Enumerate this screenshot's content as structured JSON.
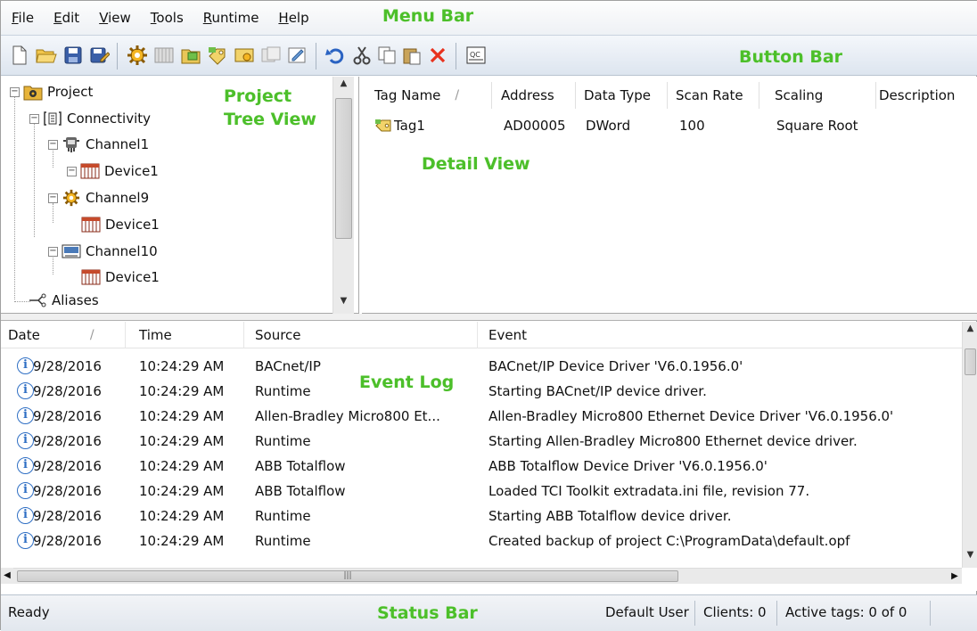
{
  "menu": {
    "items": [
      {
        "label": "File",
        "ul": "F",
        "rest": "ile"
      },
      {
        "label": "Edit",
        "ul": "E",
        "rest": "dit"
      },
      {
        "label": "View",
        "ul": "V",
        "rest": "iew"
      },
      {
        "label": "Tools",
        "ul": "T",
        "rest": "ools"
      },
      {
        "label": "Runtime",
        "ul": "R",
        "rest": "untime"
      },
      {
        "label": "Help",
        "ul": "H",
        "rest": "elp"
      }
    ]
  },
  "callouts": {
    "menu_bar": "Menu Bar",
    "button_bar": "Button Bar",
    "project_tree_view_1": "Project",
    "project_tree_view_2": "Tree View",
    "detail_view": "Detail View",
    "event_log": "Event Log",
    "status_bar": "Status Bar"
  },
  "toolbar": {
    "buttons": [
      "new-file-icon",
      "open-folder-icon",
      "save-icon",
      "save-as-icon",
      "new-channel-icon",
      "new-device-icon",
      "new-tag-group-icon",
      "new-tag-icon",
      "bulk-tag-icon",
      "duplicate-icon",
      "properties-icon",
      "undo-icon",
      "cut-icon",
      "copy-icon",
      "paste-icon",
      "delete-icon",
      "quick-client-icon"
    ]
  },
  "tree": {
    "project": "Project",
    "connectivity": "Connectivity",
    "channel1": "Channel1",
    "channel1_device": "Device1",
    "channel9": "Channel9",
    "channel9_device": "Device1",
    "channel10": "Channel10",
    "channel10_device": "Device1",
    "aliases": "Aliases"
  },
  "detail": {
    "columns": {
      "tag_name": "Tag Name",
      "address": "Address",
      "data_type": "Data Type",
      "scan_rate": "Scan Rate",
      "scaling": "Scaling",
      "description": "Description"
    },
    "rows": [
      {
        "tag_name": "Tag1",
        "address": "AD00005",
        "data_type": "DWord",
        "scan_rate": "100",
        "scaling": "Square Root"
      }
    ]
  },
  "event_log": {
    "columns": {
      "date": "Date",
      "time": "Time",
      "source": "Source",
      "event": "Event"
    },
    "rows": [
      {
        "date": "9/28/2016",
        "time": "10:24:29 AM",
        "source": "BACnet/IP",
        "event": "BACnet/IP Device Driver 'V6.0.1956.0'"
      },
      {
        "date": "9/28/2016",
        "time": "10:24:29 AM",
        "source": "Runtime",
        "event": "Starting BACnet/IP device driver."
      },
      {
        "date": "9/28/2016",
        "time": "10:24:29 AM",
        "source": "Allen-Bradley Micro800 Et...",
        "event": "Allen-Bradley Micro800 Ethernet Device Driver 'V6.0.1956.0'"
      },
      {
        "date": "9/28/2016",
        "time": "10:24:29 AM",
        "source": "Runtime",
        "event": "Starting Allen-Bradley Micro800 Ethernet device driver."
      },
      {
        "date": "9/28/2016",
        "time": "10:24:29 AM",
        "source": "ABB Totalflow",
        "event": "ABB Totalflow Device Driver 'V6.0.1956.0'"
      },
      {
        "date": "9/28/2016",
        "time": "10:24:29 AM",
        "source": "ABB Totalflow",
        "event": "Loaded TCI Toolkit extradata.ini file, revision 77."
      },
      {
        "date": "9/28/2016",
        "time": "10:24:29 AM",
        "source": "Runtime",
        "event": "Starting ABB Totalflow device driver."
      },
      {
        "date": "9/28/2016",
        "time": "10:24:29 AM",
        "source": "Runtime",
        "event": "Created backup of project  C:\\ProgramData\\default.opf"
      }
    ]
  },
  "status": {
    "ready": "Ready",
    "user": "Default User",
    "clients": "Clients: 0",
    "active_tags": "Active tags: 0 of 0"
  }
}
